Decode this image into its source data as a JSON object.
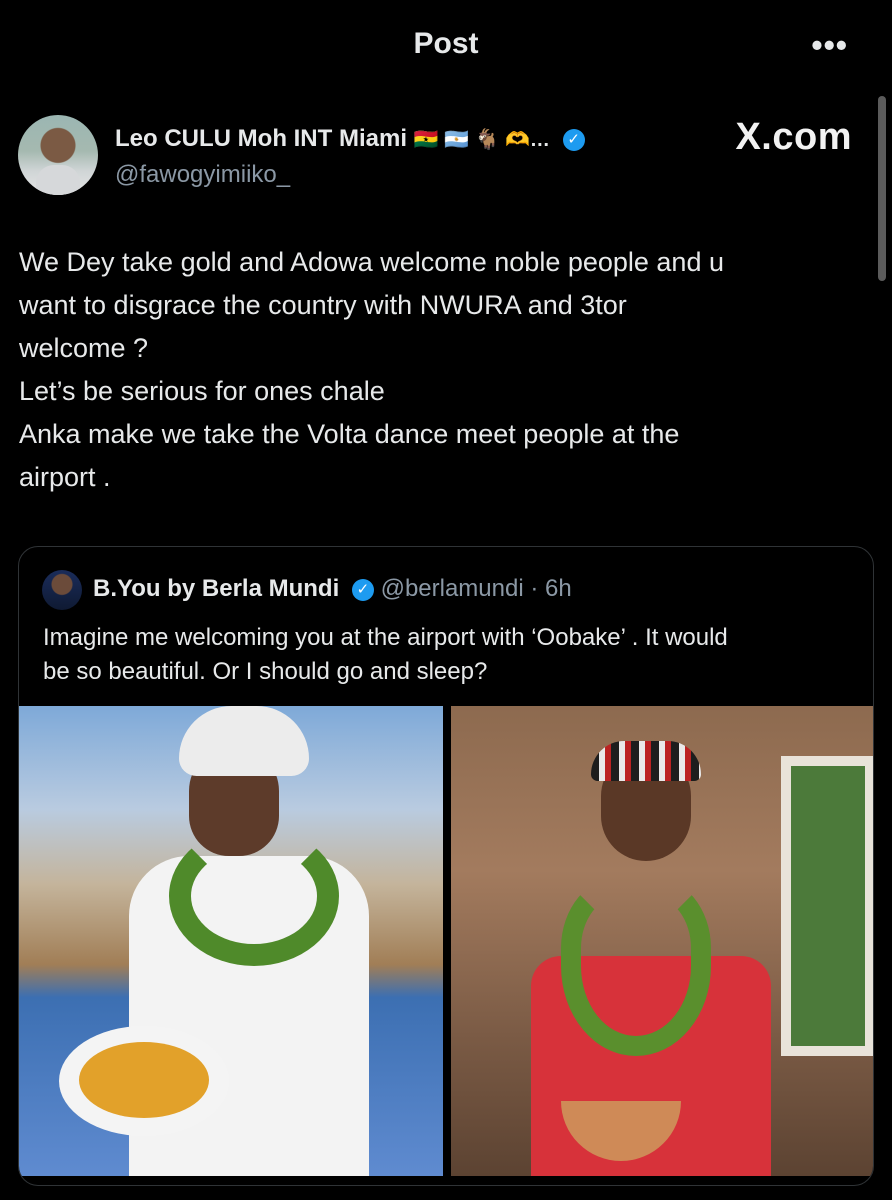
{
  "header": {
    "title": "Post",
    "more_icon": "more-icon",
    "more_glyph": "•••"
  },
  "author": {
    "name": "Leo CULU Moh INT Miami",
    "name_emojis": "🇬🇭 🇦🇷  🐐 🫶…",
    "verified": true,
    "handle": "@fawogyimiiko_"
  },
  "watermark": "X.com",
  "post": {
    "lines": [
      "We Dey take gold and Adowa welcome noble people and u",
      "want to disgrace the country with NWURA and 3tor",
      "welcome ?",
      "Let’s be serious for ones chale",
      "Anka make we take the Volta dance meet people at the",
      "airport ."
    ]
  },
  "quote": {
    "name": "B.You by Berla Mundi",
    "verified": true,
    "handle_time": "@berlamundi · 6h",
    "lines": [
      "Imagine me welcoming you at the airport with ‘Oobake’ . It would",
      "be so beautiful. Or I should go and sleep?"
    ]
  },
  "colors": {
    "accent": "#1d9bf0",
    "background": "#000000",
    "secondary_text": "#8b98a5"
  }
}
